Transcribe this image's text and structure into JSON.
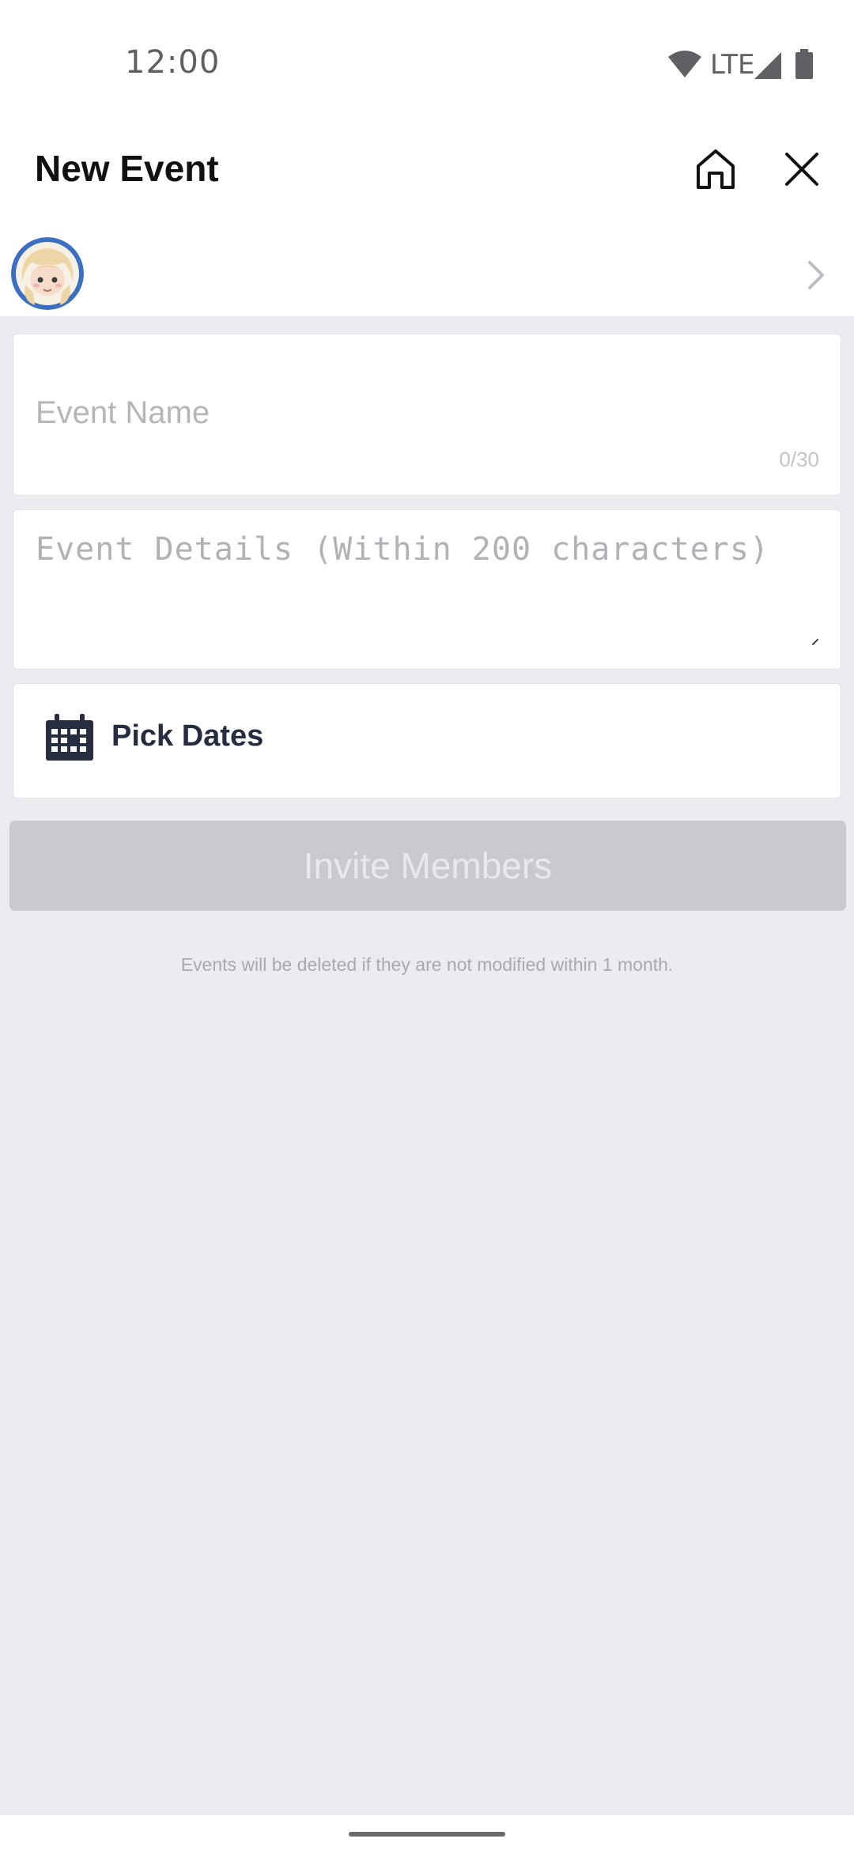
{
  "status_bar": {
    "time": "12:00",
    "network": "LTE",
    "icons": [
      "wifi-icon",
      "signal-icon",
      "battery-icon"
    ]
  },
  "header": {
    "title": "New Event",
    "icons": [
      "home-icon",
      "close-icon"
    ]
  },
  "profile_row": {
    "icons": [
      "avatar",
      "chevron-right-icon"
    ]
  },
  "form": {
    "event_name_placeholder": "Event Name",
    "event_name_counter": "0/30",
    "event_details_placeholder": "Event Details (Within 200 characters)",
    "pick_dates_label": "Pick Dates",
    "pick_dates_icon": "calendar-icon"
  },
  "actions": {
    "invite_label": "Invite Members"
  },
  "note": "Events will be deleted if they are not modified within 1 month.",
  "colors": {
    "background": "#ecebf0",
    "button_disabled": "#c8cad0",
    "calendar_icon": "#272d40",
    "avatar_ring": "#3d6fc0"
  }
}
